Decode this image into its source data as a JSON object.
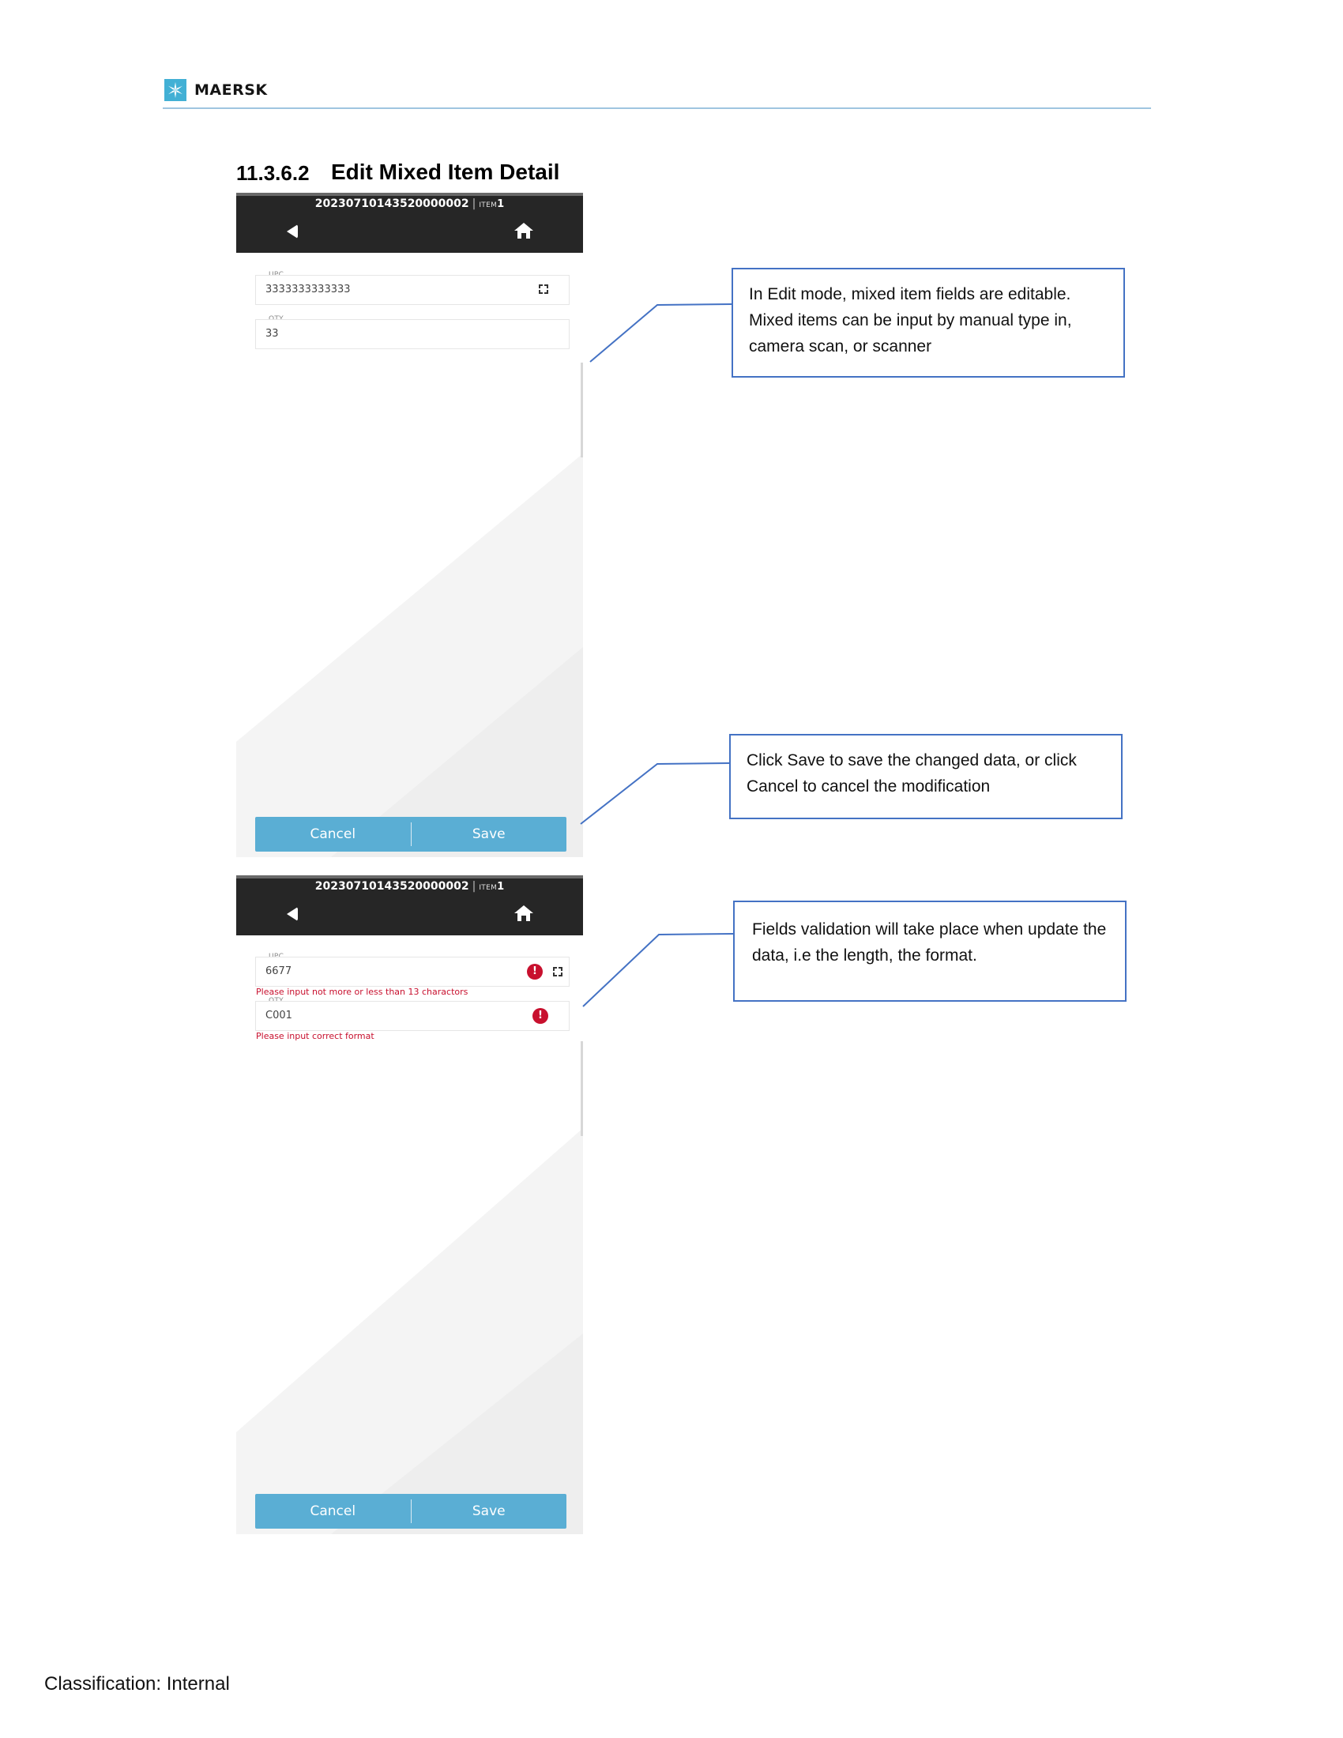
{
  "header": {
    "brand": "MAERSK",
    "logo_icon": "maersk-star-icon",
    "brand_color": "#42b0d5"
  },
  "section": {
    "number": "11.3.6.2",
    "title": "Edit Mixed Item Detail"
  },
  "screens": [
    {
      "order_id": "20230710143520000002",
      "item_label": "ITEM",
      "item_number": "1",
      "fields": [
        {
          "label": "UPC",
          "value": "3333333333333"
        },
        {
          "label": "QTY",
          "value": "33"
        }
      ],
      "cancel_label": "Cancel",
      "save_label": "Save"
    },
    {
      "order_id": "20230710143520000002",
      "item_label": "ITEM",
      "item_number": "1",
      "fields": [
        {
          "label": "UPC",
          "value": "6677",
          "error": "Please input not more or less than 13 charactors"
        },
        {
          "label": "QTY",
          "value": "C001",
          "error": "Please input correct format"
        }
      ],
      "cancel_label": "Cancel",
      "save_label": "Save"
    }
  ],
  "callouts": [
    "In Edit mode, mixed item fields are editable. Mixed items can be input by manual type in, camera scan, or scanner",
    "Click Save to save the changed data, or click Cancel to cancel the modification",
    "Fields validation will take place when update the data, i.e the length, the format."
  ],
  "footer": {
    "classification": "Classification: Internal"
  },
  "colors": {
    "header_bar": "#262626",
    "button_bar": "#5aaed4",
    "error": "#c8102e",
    "callout_border": "#4472c4"
  }
}
